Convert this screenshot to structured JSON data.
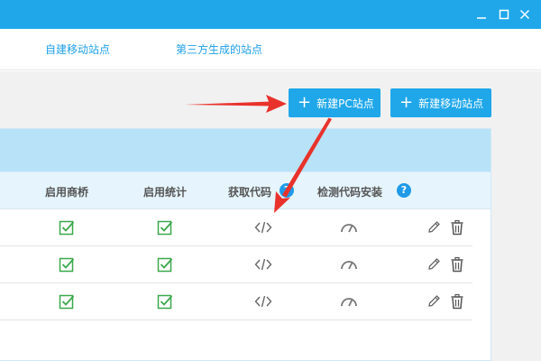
{
  "titlebar": {
    "controls": [
      {
        "name": "minimize-button",
        "icon": "minimize-icon"
      },
      {
        "name": "maximize-button",
        "icon": "maximize-icon"
      },
      {
        "name": "close-button",
        "icon": "close-icon"
      }
    ]
  },
  "nav": {
    "tabs": [
      {
        "label": "自建移动站点"
      },
      {
        "label": "第三方生成的站点"
      }
    ]
  },
  "toolbar": {
    "new_pc_site_label": "新建PC站点",
    "new_mobile_site_label": "新建移动站点",
    "plus_icon": "plus-icon"
  },
  "table": {
    "columns": [
      {
        "label": "启用商桥"
      },
      {
        "label": "启用统计"
      },
      {
        "label": "获取代码",
        "help": true
      },
      {
        "label": "检测代码安装",
        "help": true
      }
    ],
    "help_glyph": "?",
    "rows": [
      {
        "shangqiao_enabled": true,
        "stats_enabled": true
      },
      {
        "shangqiao_enabled": true,
        "stats_enabled": true
      },
      {
        "shangqiao_enabled": true,
        "stats_enabled": true
      }
    ],
    "icons": {
      "check": "checkbox-checked-icon",
      "code": "code-icon",
      "detect": "gauge-icon",
      "edit": "pencil-icon",
      "delete": "trash-icon"
    }
  },
  "colors": {
    "titlebar": "#1fa7ea",
    "accent": "#1fa7ea",
    "nav_text": "#1fa0e8",
    "panel_header": "#b8e2f8",
    "table_header": "#e6f5fd",
    "check_green": "#3aa84a",
    "annotation_arrow": "#e8322b"
  },
  "annotations": [
    {
      "type": "arrow",
      "points_to": "new-pc-site-button"
    },
    {
      "type": "arrow",
      "points_to": "get-code-icon-row-1"
    }
  ]
}
